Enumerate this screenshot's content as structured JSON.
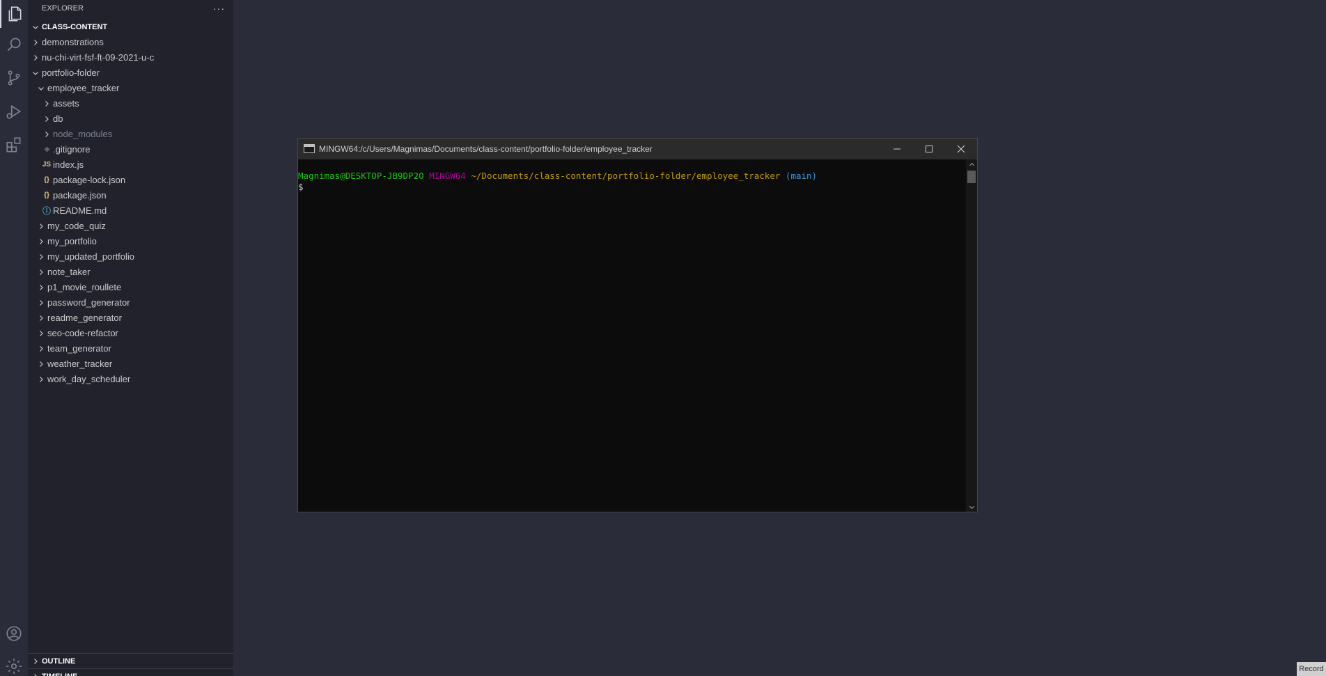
{
  "sidebar": {
    "header": "EXPLORER",
    "more_actions": "···",
    "root_section": "CLASS-CONTENT",
    "tree": [
      {
        "label": "demonstrations",
        "kind": "folder",
        "open": false,
        "depth": 0
      },
      {
        "label": "nu-chi-virt-fsf-ft-09-2021-u-c",
        "kind": "folder",
        "open": false,
        "depth": 0
      },
      {
        "label": "portfolio-folder",
        "kind": "folder",
        "open": true,
        "depth": 0
      },
      {
        "label": "employee_tracker",
        "kind": "folder",
        "open": true,
        "depth": 1
      },
      {
        "label": "assets",
        "kind": "folder",
        "open": false,
        "depth": 2
      },
      {
        "label": "db",
        "kind": "folder",
        "open": false,
        "depth": 2
      },
      {
        "label": "node_modules",
        "kind": "folder",
        "open": false,
        "depth": 2,
        "dim": true
      },
      {
        "label": ".gitignore",
        "kind": "file",
        "icon": "gitignore-icon",
        "depth": 2
      },
      {
        "label": "index.js",
        "kind": "file",
        "icon": "js-file-icon",
        "glyph": "JS",
        "depth": 2
      },
      {
        "label": "package-lock.json",
        "kind": "file",
        "icon": "json-file-icon",
        "glyph": "{}",
        "depth": 2
      },
      {
        "label": "package.json",
        "kind": "file",
        "icon": "json-file-icon",
        "glyph": "{}",
        "depth": 2
      },
      {
        "label": "README.md",
        "kind": "file",
        "icon": "info-file-icon",
        "glyph": "ⓘ",
        "depth": 2
      },
      {
        "label": "my_code_quiz",
        "kind": "folder",
        "open": false,
        "depth": 1
      },
      {
        "label": "my_portfolio",
        "kind": "folder",
        "open": false,
        "depth": 1
      },
      {
        "label": "my_updated_portfolio",
        "kind": "folder",
        "open": false,
        "depth": 1
      },
      {
        "label": "note_taker",
        "kind": "folder",
        "open": false,
        "depth": 1
      },
      {
        "label": "p1_movie_roullete",
        "kind": "folder",
        "open": false,
        "depth": 1
      },
      {
        "label": "password_generator",
        "kind": "folder",
        "open": false,
        "depth": 1
      },
      {
        "label": "readme_generator",
        "kind": "folder",
        "open": false,
        "depth": 1
      },
      {
        "label": "seo-code-refactor",
        "kind": "folder",
        "open": false,
        "depth": 1
      },
      {
        "label": "team_generator",
        "kind": "folder",
        "open": false,
        "depth": 1
      },
      {
        "label": "weather_tracker",
        "kind": "folder",
        "open": false,
        "depth": 1
      },
      {
        "label": "work_day_scheduler",
        "kind": "folder",
        "open": false,
        "depth": 1
      }
    ],
    "outline_label": "OUTLINE",
    "timeline_label": "TIMELINE"
  },
  "terminal": {
    "title": "MINGW64:/c/Users/Magnimas/Documents/class-content/portfolio-folder/employee_tracker",
    "prompt_user": "Magnimas@DESKTOP-JB9DP2O",
    "prompt_shell": "MINGW64",
    "prompt_path": "~/Documents/class-content/portfolio-folder/employee_tracker",
    "prompt_branch": "(main)",
    "prompt_symbol": "$"
  },
  "record_badge": "Record",
  "colors": {
    "editor_bg": "#2a2c3a",
    "sidebar_bg": "#21222c",
    "terminal_bg": "#0c0c0c",
    "json_icon": "#e5c07b",
    "js_icon": "#e5c07b",
    "info_icon": "#519aba"
  }
}
